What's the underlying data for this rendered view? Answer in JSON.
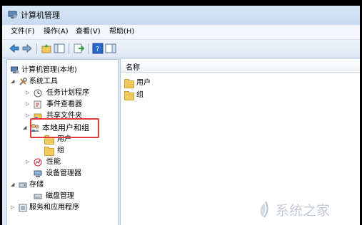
{
  "window": {
    "title": "计算机管理"
  },
  "menu": [
    "文件(F)",
    "操作(A)",
    "查看(V)",
    "帮助(H)"
  ],
  "tree": {
    "root": "计算机管理(本地)",
    "system_tools": "系统工具",
    "task_scheduler": "任务计划程序",
    "event_viewer": "事件查看器",
    "shared_folders": "共享文件夹",
    "local_users_groups": "本地用户和组",
    "users": "用户",
    "groups": "组",
    "performance": "性能",
    "device_manager": "设备管理器",
    "storage": "存储",
    "disk_management": "磁盘管理",
    "services_apps": "服务和应用程序"
  },
  "list": {
    "column_name": "名称",
    "items": [
      "用户",
      "组"
    ]
  },
  "watermark": {
    "text": "系统之家"
  },
  "colors": {
    "highlight_border": "#e23c3c",
    "folder": "#f0ca5c",
    "window_bg": "#dfe9f5"
  }
}
